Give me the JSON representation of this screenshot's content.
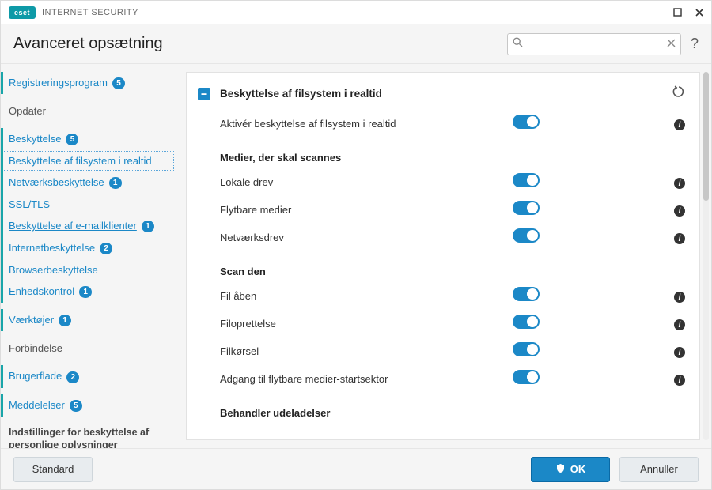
{
  "brand": {
    "logo_text": "eset",
    "product": "INTERNET SECURITY"
  },
  "window": {
    "maximize": "▢",
    "close": "✕"
  },
  "header": {
    "title": "Avanceret opsætning",
    "search_placeholder": "",
    "help": "?"
  },
  "sidebar": {
    "items": [
      {
        "label": "Registreringsprogram",
        "badge": "5",
        "level": "l1",
        "plainbar": false
      },
      {
        "label": "Opdater",
        "level": "plain"
      },
      {
        "label": "Beskyttelse",
        "badge": "5",
        "level": "l1"
      },
      {
        "label": "Beskyttelse af filsystem i realtid",
        "level": "sub",
        "active": true
      },
      {
        "label": "Netværksbeskyttelse",
        "badge": "1",
        "level": "sub"
      },
      {
        "label": "SSL/TLS",
        "level": "sub"
      },
      {
        "label": "Beskyttelse af e-mailklienter",
        "badge": "1",
        "level": "sub",
        "underline": true
      },
      {
        "label": "Internetbeskyttelse",
        "badge": "2",
        "level": "sub"
      },
      {
        "label": "Browserbeskyttelse",
        "level": "sub"
      },
      {
        "label": "Enhedskontrol",
        "badge": "1",
        "level": "sub"
      },
      {
        "label": "Værktøjer",
        "badge": "1",
        "level": "l1"
      },
      {
        "label": "Forbindelse",
        "level": "plain"
      },
      {
        "label": "Brugerflade",
        "badge": "2",
        "level": "l1"
      },
      {
        "label": "Meddelelser",
        "badge": "5",
        "level": "l1"
      }
    ],
    "footnote": "Indstillinger for beskyttelse af personlige oplysninger"
  },
  "content": {
    "section_title": "Beskyttelse af filsystem i realtid",
    "rows1": [
      {
        "label": "Aktivér beskyttelse af filsystem i realtid",
        "on": true
      }
    ],
    "sub1": "Medier, der skal scannes",
    "rows2": [
      {
        "label": "Lokale drev",
        "on": true
      },
      {
        "label": "Flytbare medier",
        "on": true
      },
      {
        "label": "Netværksdrev",
        "on": true
      }
    ],
    "sub2": "Scan den",
    "rows3": [
      {
        "label": "Fil åben",
        "on": true
      },
      {
        "label": "Filoprettelse",
        "on": true
      },
      {
        "label": "Filkørsel",
        "on": true
      },
      {
        "label": "Adgang til flytbare medier-startsektor",
        "on": true
      }
    ],
    "sub3": "Behandler udeladelser"
  },
  "footer": {
    "default": "Standard",
    "ok": "OK",
    "cancel": "Annuller"
  }
}
